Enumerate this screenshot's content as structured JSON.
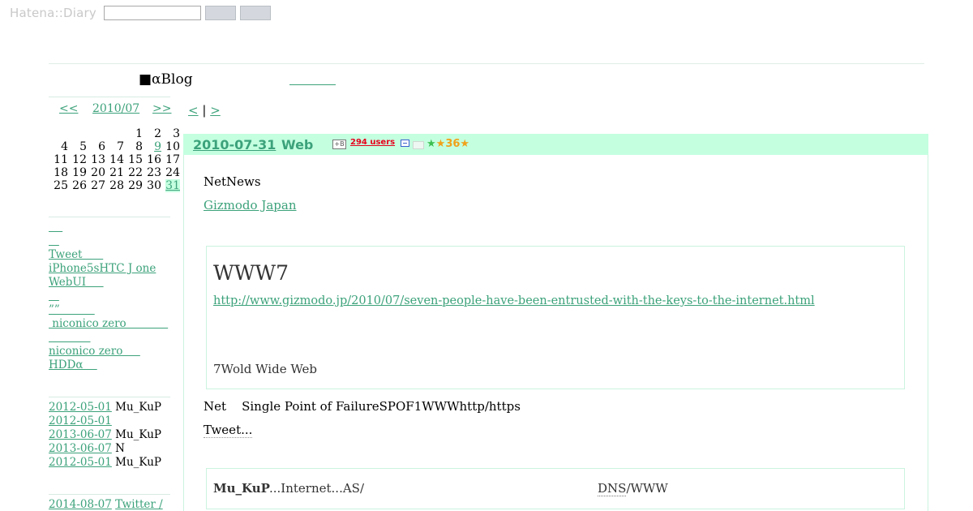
{
  "topbar": {
    "logo": "Hatena::Diary"
  },
  "blog": {
    "title": "■αBlog"
  },
  "calendar": {
    "prev": "<<",
    "month": "2010/07",
    "next": ">>",
    "weeks": [
      [
        "",
        "",
        "",
        "",
        "1",
        "2",
        "3"
      ],
      [
        "4",
        "5",
        "6",
        "7",
        "8",
        "9",
        "10"
      ],
      [
        "11",
        "12",
        "13",
        "14",
        "15",
        "16",
        "17"
      ],
      [
        "18",
        "19",
        "20",
        "21",
        "22",
        "23",
        "24"
      ],
      [
        "25",
        "26",
        "27",
        "28",
        "29",
        "30",
        "31"
      ]
    ],
    "linked_days": [
      "9",
      "31"
    ],
    "today": "31"
  },
  "nav_links": [
    "    ",
    "   ",
    "Tweet      ",
    "iPhone5sHTC J one",
    "WebUI     ",
    "   ",
    "””          ",
    " niconico zero            ",
    "            ",
    "niconico zero     ",
    "HDDα    "
  ],
  "recent_comments": [
    {
      "date": "2012-05-01",
      "user": "Mu_KuP"
    },
    {
      "date": "2012-05-01",
      "user": ""
    },
    {
      "date": "2013-06-07",
      "user": "Mu_KuP"
    },
    {
      "date": "2013-06-07",
      "user": "N"
    },
    {
      "date": "2012-05-01",
      "user": "Mu_KuP"
    }
  ],
  "recent2": {
    "date": "2014-08-07",
    "link": "Twitter /"
  },
  "pager": {
    "prev": "<",
    "sep": "|",
    "next": ">"
  },
  "entry": {
    "date": "2010-07-31",
    "category": "Web",
    "bookmark_icon": "+B",
    "bookmark_count": "294 users",
    "star_count": "36",
    "section_title": "NetNews",
    "source_link": "Gizmodo Japan",
    "quote": {
      "title": "WWW7",
      "url": "http://www.gizmodo.jp/2010/07/seven-people-have-been-entrusted-with-the-keys-to-the-internet.html",
      "text": "7Wold Wide Web"
    },
    "body_text": "Net    Single Point of FailureSPOF1WWWhttp/https",
    "tweet_more": "Tweet...",
    "comment": {
      "user": "Mu_KuP",
      "text": "...Internet...AS/",
      "dns": "DNS",
      "dns_rest": "/WWW"
    }
  },
  "colors": {
    "accent": "#3ca27b",
    "header_bg": "#c4ffe0",
    "border": "#cbf3df"
  }
}
